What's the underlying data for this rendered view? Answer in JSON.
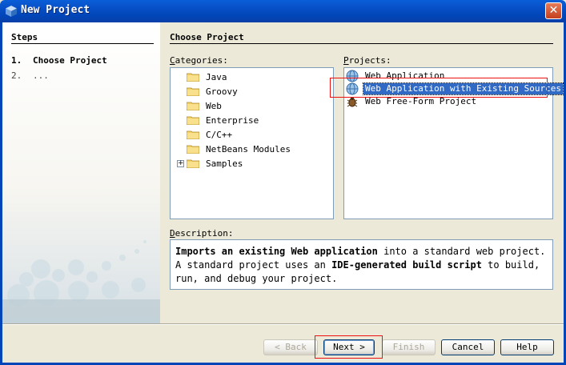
{
  "window": {
    "title": "New Project",
    "close_glyph": "✕"
  },
  "steps": {
    "title": "Steps",
    "items": [
      {
        "num": "1.",
        "label": "Choose Project"
      },
      {
        "num": "2.",
        "label": "..."
      }
    ]
  },
  "panel": {
    "title": "Choose Project",
    "categories_label_key": "C",
    "categories_label_rest": "ategories:",
    "projects_label_key": "P",
    "projects_label_rest": "rojects:",
    "description_label_key": "D",
    "description_label_rest": "escription:"
  },
  "categories": [
    {
      "label": "Java",
      "icon": "folder-icon"
    },
    {
      "label": "Groovy",
      "icon": "folder-icon"
    },
    {
      "label": "Web",
      "icon": "folder-icon"
    },
    {
      "label": "Enterprise",
      "icon": "folder-icon"
    },
    {
      "label": "C/C++",
      "icon": "folder-icon"
    },
    {
      "label": "NetBeans Modules",
      "icon": "folder-icon"
    },
    {
      "label": "Samples",
      "icon": "folder-icon",
      "expandable": true,
      "expander": "+"
    }
  ],
  "projects": [
    {
      "label": "Web Application",
      "icon": "globe-icon"
    },
    {
      "label": "Web Application with Existing Sources",
      "icon": "globe-icon",
      "selected": true
    },
    {
      "label": "Web Free-Form Project",
      "icon": "bug-icon"
    }
  ],
  "description": {
    "p1_bold": "Imports an existing Web application",
    "p2": " into a standard web project. A standard project uses an ",
    "p3_bold": "IDE-generated build script",
    "p4": " to build, run, and debug your project."
  },
  "buttons": {
    "back": "< Back",
    "next": "Next >",
    "finish": "Finish",
    "cancel": "Cancel",
    "help": "Help"
  },
  "colors": {
    "titlebar": "#0a5fd8",
    "selection": "#316ac5",
    "highlight": "#e11111"
  }
}
